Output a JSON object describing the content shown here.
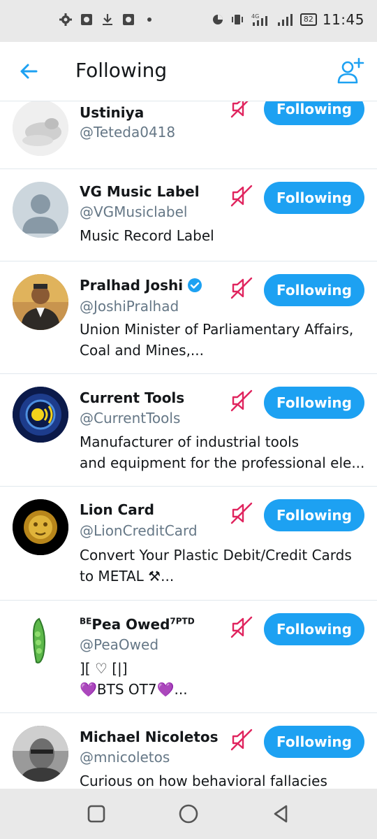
{
  "status": {
    "time": "11:45",
    "battery": "82",
    "network": "4G"
  },
  "header": {
    "title": "Following"
  },
  "users": [
    {
      "name": "Ustiniya",
      "handle": "@Teteda0418",
      "bio": [],
      "verified": false,
      "button": "Following"
    },
    {
      "name": "VG Music Label",
      "handle": "@VGMusiclabel",
      "bio": [
        "Music Record Label"
      ],
      "verified": false,
      "button": "Following"
    },
    {
      "name": "Pralhad Joshi",
      "handle": "@JoshiPralhad",
      "bio": [
        "Union Minister of Parliamentary Affairs,",
        "Coal and Mines,..."
      ],
      "verified": true,
      "button": "Following"
    },
    {
      "name": "Current Tools",
      "handle": "@CurrentTools",
      "bio": [
        "Manufacturer of industrial tools",
        "and equipment for the professional ele..."
      ],
      "verified": false,
      "button": "Following"
    },
    {
      "name": "Lion Card",
      "handle": "@LionCreditCard",
      "bio": [
        "Convert Your Plastic Debit/Credit Cards",
        "to METAL ⚒..."
      ],
      "verified": false,
      "button": "Following"
    },
    {
      "name_prefix": "BE",
      "name": "Pea Owed",
      "name_suffix": "7PTD",
      "handle": "@PeaOwed",
      "bio": [
        "][ ♡ [|]",
        "💜BTS OT7💜..."
      ],
      "verified": false,
      "button": "Following"
    },
    {
      "name": "Michael Nicoletos",
      "handle": "@mnicoletos",
      "bio": [
        "Curious on how behavioral fallacies"
      ],
      "verified": false,
      "button": "Following"
    }
  ],
  "colors": {
    "accent": "#1da1f2",
    "mute": "#e0245e",
    "handle": "#657786"
  }
}
